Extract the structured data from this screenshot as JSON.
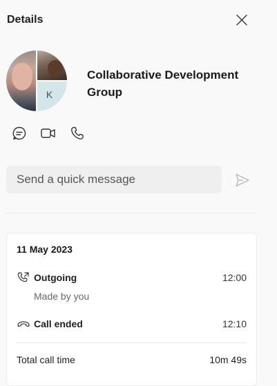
{
  "header": {
    "title": "Details",
    "close_icon": "close-icon"
  },
  "group": {
    "name": "Collaborative Development Group",
    "avatar_initial": "K"
  },
  "actions": [
    {
      "name": "chat-icon"
    },
    {
      "name": "video-icon"
    },
    {
      "name": "phone-icon"
    }
  ],
  "quick_message": {
    "placeholder": "Send a quick message",
    "value": ""
  },
  "call_log": {
    "date": "11 May 2023",
    "outgoing": {
      "label": "Outgoing",
      "time": "12:00",
      "detail": "Made by you"
    },
    "ended": {
      "label": "Call ended",
      "time": "12:10"
    },
    "total": {
      "label": "Total call time",
      "value": "10m 49s"
    }
  },
  "colors": {
    "background": "#f9f9f9",
    "card": "#ffffff",
    "input": "#efefef"
  }
}
